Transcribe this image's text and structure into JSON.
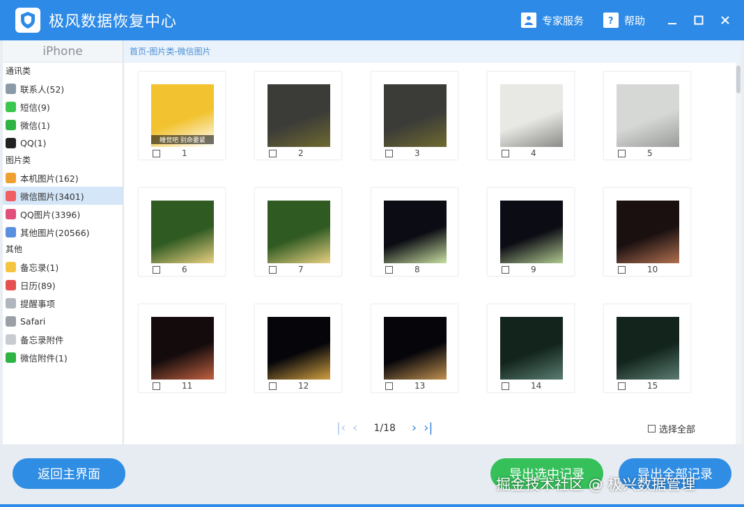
{
  "app": {
    "title": "极风数据恢复中心"
  },
  "titlebar": {
    "expert_label": "专家服务",
    "help_label": "帮助"
  },
  "sidebar": {
    "device": "iPhone",
    "groups": [
      {
        "label": "通讯类",
        "items": [
          {
            "label": "联系人(52)",
            "icon": "contacts-icon",
            "color": "#8a9aa8"
          },
          {
            "label": "短信(9)",
            "icon": "sms-icon",
            "color": "#3cc74e"
          },
          {
            "label": "微信(1)",
            "icon": "wechat-icon",
            "color": "#2fb344"
          },
          {
            "label": "QQ(1)",
            "icon": "qq-icon",
            "color": "#222222"
          }
        ]
      },
      {
        "label": "图片类",
        "items": [
          {
            "label": "本机图片(162)",
            "icon": "photos-icon",
            "color": "#f0a030"
          },
          {
            "label": "微信图片(3401)",
            "icon": "photos-icon",
            "color": "#f06060",
            "active": true
          },
          {
            "label": "QQ图片(3396)",
            "icon": "photos-icon",
            "color": "#e0507a"
          },
          {
            "label": "其他图片(20566)",
            "icon": "photos-icon",
            "color": "#5a8fe0"
          }
        ]
      },
      {
        "label": "其他",
        "items": [
          {
            "label": "备忘录(1)",
            "icon": "notes-icon",
            "color": "#f5c542"
          },
          {
            "label": "日历(89)",
            "icon": "calendar-icon",
            "color": "#e55050"
          },
          {
            "label": "提醒事项",
            "icon": "reminders-icon",
            "color": "#b0b6bd"
          },
          {
            "label": "Safari",
            "icon": "safari-icon",
            "color": "#9aa0a6"
          },
          {
            "label": "备忘录附件",
            "icon": "attachment-icon",
            "color": "#c7ccd1"
          },
          {
            "label": "微信附件(1)",
            "icon": "wechat-icon",
            "color": "#2fb344"
          }
        ]
      }
    ]
  },
  "breadcrumb": "首页-图片类-微信图片",
  "photos": [
    {
      "num": "1",
      "colors": [
        "#f2c230",
        "#ffffff"
      ],
      "caption": "睡觉吧 别命要紧"
    },
    {
      "num": "2",
      "colors": [
        "#3b3b38",
        "#6e6a30"
      ]
    },
    {
      "num": "3",
      "colors": [
        "#3b3b38",
        "#6e6a30"
      ]
    },
    {
      "num": "4",
      "colors": [
        "#e8e8e4",
        "#8a8a88"
      ]
    },
    {
      "num": "5",
      "colors": [
        "#d6d8d6",
        "#9a9c9a"
      ]
    },
    {
      "num": "6",
      "colors": [
        "#2f5a22",
        "#e8d080"
      ]
    },
    {
      "num": "7",
      "colors": [
        "#2f5a22",
        "#e8d080"
      ]
    },
    {
      "num": "8",
      "colors": [
        "#0c0c14",
        "#c8e0a0"
      ]
    },
    {
      "num": "9",
      "colors": [
        "#0c0c14",
        "#b0c890"
      ]
    },
    {
      "num": "10",
      "colors": [
        "#1a1010",
        "#b07050"
      ]
    },
    {
      "num": "11",
      "colors": [
        "#140c0c",
        "#c06040"
      ]
    },
    {
      "num": "12",
      "colors": [
        "#05050a",
        "#d0a040"
      ]
    },
    {
      "num": "13",
      "colors": [
        "#05050a",
        "#c09050"
      ]
    },
    {
      "num": "14",
      "colors": [
        "#12241c",
        "#5a7c70"
      ]
    },
    {
      "num": "15",
      "colors": [
        "#12241c",
        "#5a7c70"
      ]
    }
  ],
  "pager": {
    "text": "1/18"
  },
  "select_all_label": "选择全部",
  "buttons": {
    "home": "返回主界面",
    "export_selected": "导出选中记录",
    "export_all": "导出全部记录"
  },
  "watermark": "掘金技术社区 @ 极兴数据管理",
  "colors": {
    "accent": "#2d8ae6",
    "green": "#35c05a"
  }
}
